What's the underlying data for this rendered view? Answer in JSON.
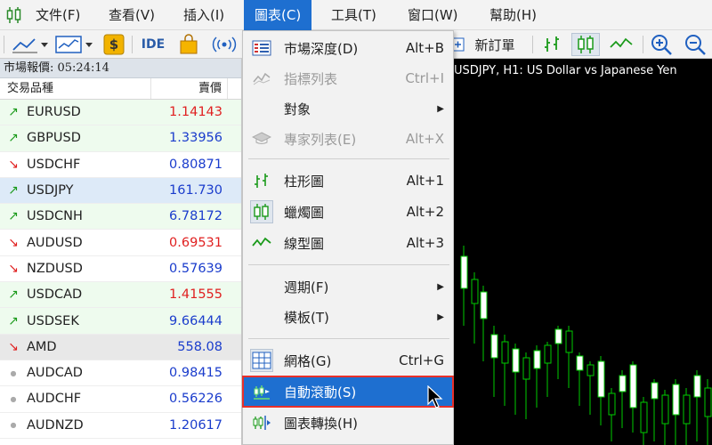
{
  "menubar": {
    "items": [
      "文件(F)",
      "查看(V)",
      "插入(I)",
      "圖表(C)",
      "工具(T)",
      "窗口(W)",
      "幫助(H)"
    ],
    "active": "圖表(C)"
  },
  "toolbar": {
    "ide_label": "IDE",
    "new_order_label": "新訂單"
  },
  "market_watch": {
    "title": "市場報價: 05:24:14",
    "col_symbol": "交易品種",
    "col_bid": "賣價",
    "rows": [
      {
        "symbol": "EURUSD",
        "bid": "1.14143",
        "dir": "up",
        "color": "#e02020"
      },
      {
        "symbol": "GBPUSD",
        "bid": "1.33956",
        "dir": "up",
        "color": "#1a3ccc"
      },
      {
        "symbol": "USDCHF",
        "bid": "0.80871",
        "dir": "down",
        "color": "#1a3ccc"
      },
      {
        "symbol": "USDJPY",
        "bid": "161.730",
        "dir": "up",
        "color": "#1a3ccc"
      },
      {
        "symbol": "USDCNH",
        "bid": "6.78172",
        "dir": "up",
        "color": "#1a3ccc"
      },
      {
        "symbol": "AUDUSD",
        "bid": "0.69531",
        "dir": "down",
        "color": "#e02020"
      },
      {
        "symbol": "NZDUSD",
        "bid": "0.57639",
        "dir": "down",
        "color": "#1a3ccc"
      },
      {
        "symbol": "USDCAD",
        "bid": "1.41555",
        "dir": "up",
        "color": "#e02020"
      },
      {
        "symbol": "USDSEK",
        "bid": "9.66444",
        "dir": "up",
        "color": "#1a3ccc"
      },
      {
        "symbol": "AMD",
        "bid": "558.08",
        "dir": "down",
        "color": "#1a3ccc"
      },
      {
        "symbol": "AUDCAD",
        "bid": "0.98415",
        "dir": "dot",
        "color": "#1a3ccc"
      },
      {
        "symbol": "AUDCHF",
        "bid": "0.56226",
        "dir": "dot",
        "color": "#1a3ccc"
      },
      {
        "symbol": "AUDNZD",
        "bid": "1.20617",
        "dir": "dot",
        "color": "#1a3ccc"
      }
    ]
  },
  "chart": {
    "title": "USDJPY, H1:  US Dollar vs Japanese Yen"
  },
  "dropdown": {
    "items": [
      {
        "label": "市場深度(D)",
        "shortcut": "Alt+B",
        "icon": "depth-of-market-icon",
        "disabled": false
      },
      {
        "label": "指標列表",
        "shortcut": "Ctrl+I",
        "icon": "indicators-list-icon",
        "disabled": true
      },
      {
        "label": "對象",
        "shortcut": "",
        "icon": "",
        "disabled": false,
        "submenu": true
      },
      {
        "label": "專家列表(E)",
        "shortcut": "Alt+X",
        "icon": "experts-list-icon",
        "disabled": true
      },
      {
        "label": "柱形圖",
        "shortcut": "Alt+1",
        "icon": "bar-chart-icon",
        "disabled": false
      },
      {
        "label": "蠟燭圖",
        "shortcut": "Alt+2",
        "icon": "candlestick-icon",
        "disabled": false
      },
      {
        "label": "線型圖",
        "shortcut": "Alt+3",
        "icon": "line-chart-icon",
        "disabled": false
      },
      {
        "label": "週期(F)",
        "shortcut": "",
        "icon": "",
        "disabled": false,
        "submenu": true
      },
      {
        "label": "模板(T)",
        "shortcut": "",
        "icon": "",
        "disabled": false,
        "submenu": true
      },
      {
        "label": "網格(G)",
        "shortcut": "Ctrl+G",
        "icon": "grid-icon",
        "disabled": false
      },
      {
        "label": "自動滾動(S)",
        "shortcut": "",
        "icon": "auto-scroll-icon",
        "disabled": false,
        "highlighted": true
      },
      {
        "label": "圖表轉換(H)",
        "shortcut": "",
        "icon": "chart-shift-icon",
        "disabled": false
      }
    ]
  },
  "colors": {
    "menu_active": "#1e6fd0",
    "highlight_outline": "#e8302a",
    "bull": "#ffffff",
    "bear": "#000000",
    "wick": "#00cc00"
  }
}
